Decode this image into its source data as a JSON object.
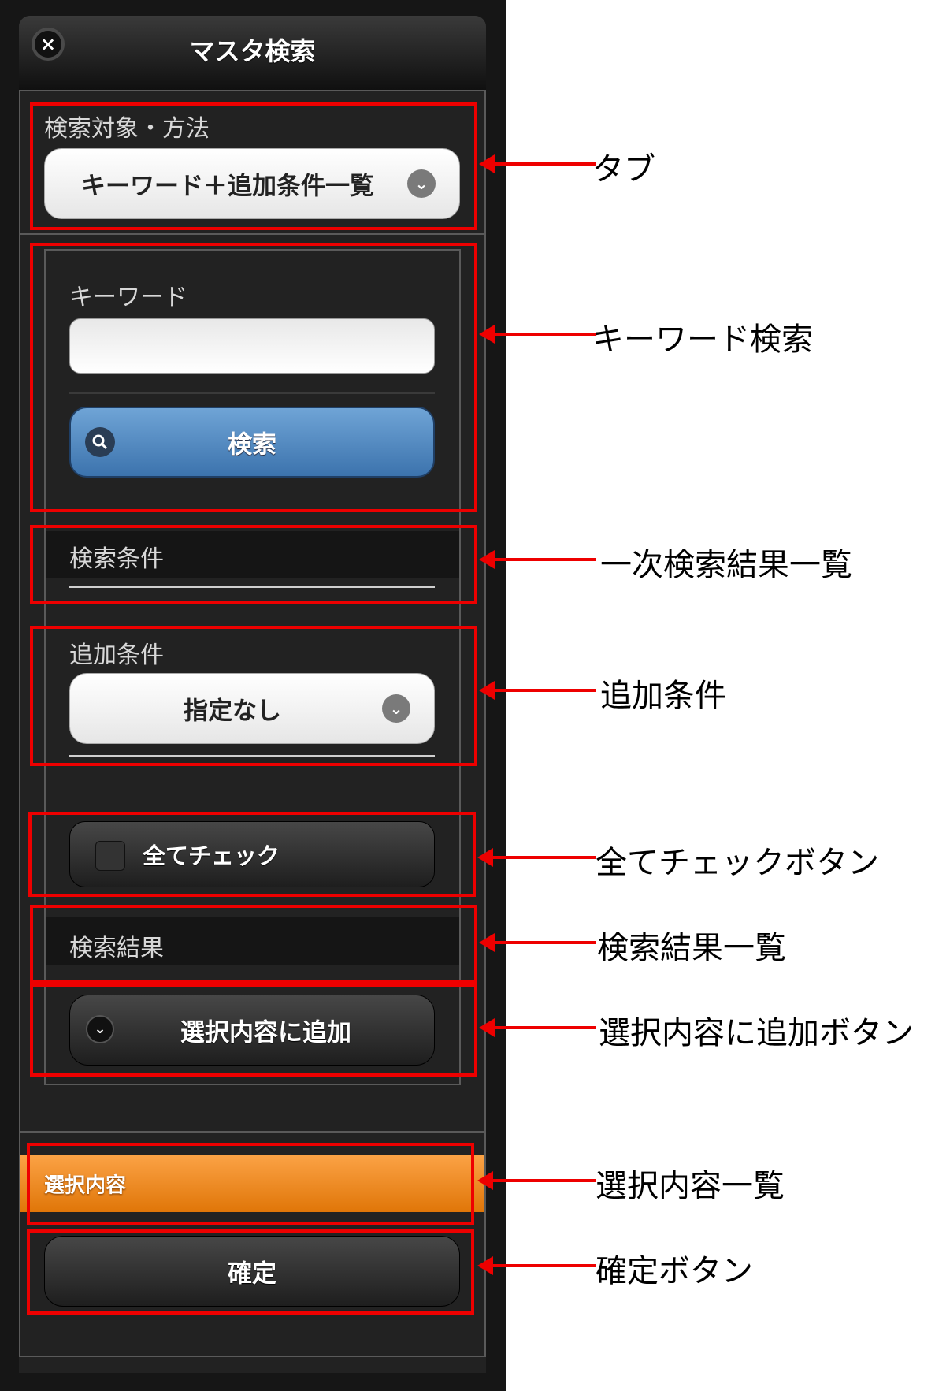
{
  "dialog": {
    "title": "マスタ検索",
    "close_icon": "×"
  },
  "search_target": {
    "label": "検索対象・方法",
    "selected": "キーワード＋追加条件一覧"
  },
  "keyword": {
    "label": "キーワード",
    "value": "",
    "placeholder": "",
    "search_button": "検索"
  },
  "search_conditions": {
    "label": "検索条件"
  },
  "additional_conditions": {
    "label": "追加条件",
    "selected": "指定なし"
  },
  "check_all": {
    "label": "全てチェック"
  },
  "search_results": {
    "label": "検索結果"
  },
  "add_selection": {
    "label": "選択内容に追加"
  },
  "selection": {
    "label": "選択内容",
    "accent_color": "#f08a1c"
  },
  "confirm": {
    "label": "確定"
  },
  "annotations": {
    "tab": "タブ",
    "keyword_search": "キーワード検索",
    "primary_results": "一次検索結果一覧",
    "additional_conditions": "追加条件",
    "check_all_button": "全てチェックボタン",
    "results_list": "検索結果一覧",
    "add_button": "選択内容に追加ボタン",
    "selection_list": "選択内容一覧",
    "confirm_button": "確定ボタン"
  },
  "annotation_color": "#ee0000"
}
